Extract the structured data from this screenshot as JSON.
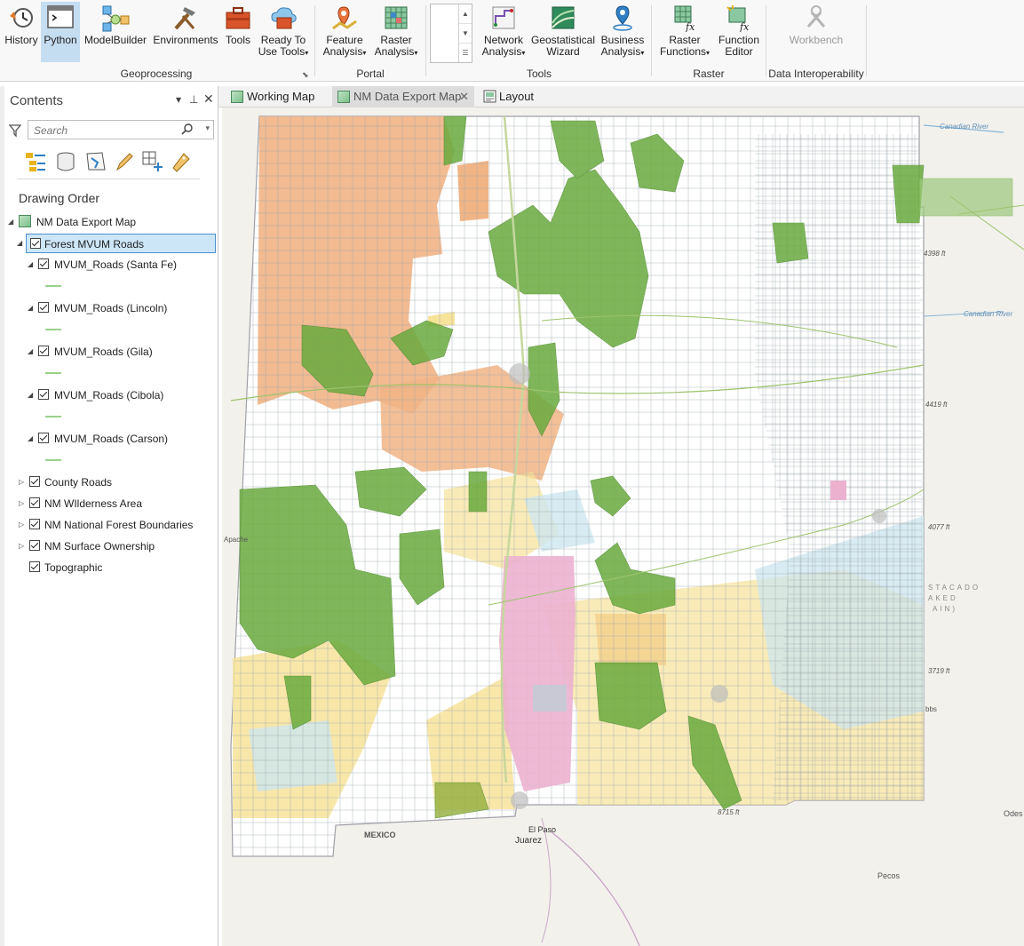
{
  "ribbon": {
    "buttons": [
      {
        "key": "history",
        "label1": "History",
        "label2": ""
      },
      {
        "key": "python",
        "label1": "Python",
        "label2": ""
      },
      {
        "key": "modelbuilder",
        "label1": "ModelBuilder",
        "label2": ""
      },
      {
        "key": "environments",
        "label1": "Environments",
        "label2": ""
      },
      {
        "key": "tools",
        "label1": "Tools",
        "label2": ""
      },
      {
        "key": "ready_to_use",
        "label1": "Ready To",
        "label2": "Use Tools"
      },
      {
        "key": "feature_analysis",
        "label1": "Feature",
        "label2": "Analysis"
      },
      {
        "key": "raster_analysis",
        "label1": "Raster",
        "label2": "Analysis"
      },
      {
        "key": "network_analysis",
        "label1": "Network",
        "label2": "Analysis"
      },
      {
        "key": "geostatistical",
        "label1": "Geostatistical",
        "label2": "Wizard"
      },
      {
        "key": "business_analysis",
        "label1": "Business",
        "label2": "Analysis"
      },
      {
        "key": "raster_functions",
        "label1": "Raster",
        "label2": "Functions"
      },
      {
        "key": "function_editor",
        "label1": "Function",
        "label2": "Editor"
      },
      {
        "key": "workbench",
        "label1": "Workbench",
        "label2": ""
      }
    ],
    "groups": {
      "geoprocessing": "Geoprocessing",
      "portal": "Portal",
      "tools": "Tools",
      "raster": "Raster",
      "data_interop": "Data Interoperability"
    },
    "active_button": "Python",
    "disabled_button": "Workbench"
  },
  "contents": {
    "title": "Contents",
    "search_placeholder": "Search",
    "section": "Drawing Order",
    "map_name": "NM Data Export Map",
    "group_layer": "Forest MVUM Roads",
    "sublayers": [
      "MVUM_Roads (Santa Fe)",
      "MVUM_Roads (Lincoln)",
      "MVUM_Roads (Gila)",
      "MVUM_Roads (Cibola)",
      "MVUM_Roads (Carson)"
    ],
    "layers": [
      "County Roads",
      "NM WIlderness Area",
      "NM National Forest Boundaries",
      "NM Surface Ownership",
      "Topographic"
    ]
  },
  "map_tabs": [
    {
      "label": "Working Map"
    },
    {
      "label": "NM Data Export Map"
    },
    {
      "label": "Layout"
    }
  ],
  "map_labels": {
    "mexico": "MEXICO",
    "el_paso": "El Paso",
    "juarez": "Juarez",
    "pecos": "Pecos",
    "odessa": "Odes",
    "canadian_river": "Canadian River",
    "canadian_river2": "Canadian River",
    "staked_plain": "STACADO",
    "staked_plain2": "AKED",
    "staked_plain3": "AIN)",
    "elev1": "4398 ft",
    "elev2": "4419 ft",
    "elev3": "4077 ft",
    "elev4": "3719 ft",
    "elev5": "8715 ft",
    "hobbs": "bbs",
    "apache": "Apache"
  },
  "colors": {
    "accent": "#2f7fc4",
    "forest_green": "#6aaa3f",
    "blm_yellow": "#f7e39a",
    "state_blue": "#cde6ef",
    "tribal_orange": "#f1b485",
    "military_pink": "#ebb1cf"
  }
}
